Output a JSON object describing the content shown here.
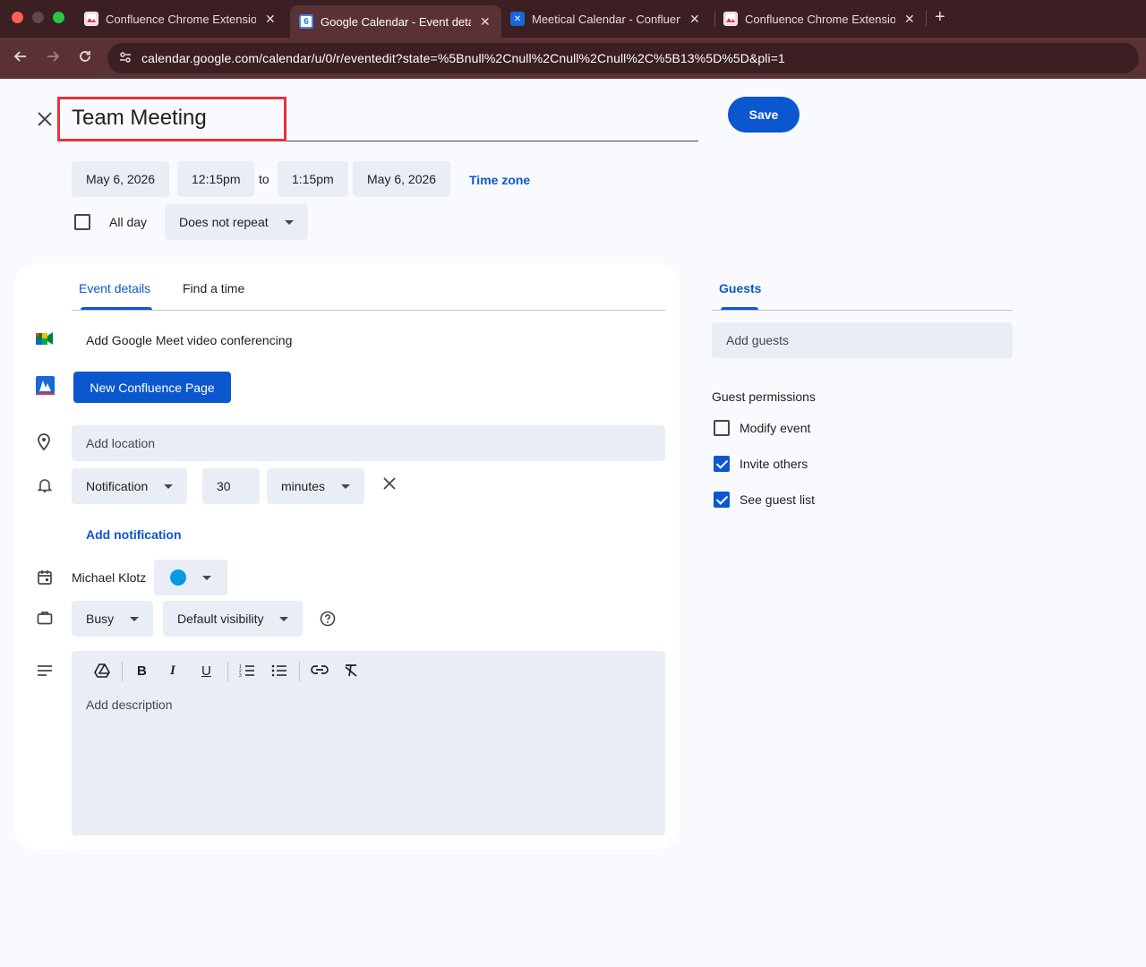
{
  "browser": {
    "tabs": [
      {
        "title": "Confluence Chrome Extension",
        "active": false
      },
      {
        "title": "Google Calendar - Event details",
        "active": true
      },
      {
        "title": "Meetical Calendar - Confluence",
        "active": false
      },
      {
        "title": "Confluence Chrome Extension",
        "active": false
      }
    ],
    "url": "calendar.google.com/calendar/u/0/r/eventedit?state=%5Bnull%2Cnull%2Cnull%2Cnull%2C%5B13%5D%5D&pli=1",
    "calendar_favicon_number": "6"
  },
  "event": {
    "title": "Team Meeting",
    "save_label": "Save",
    "start_date": "May 6, 2026",
    "start_time": "12:15pm",
    "to_label": "to",
    "end_time": "1:15pm",
    "end_date": "May 6, 2026",
    "time_zone_label": "Time zone",
    "all_day_label": "All day",
    "repeat_label": "Does not repeat"
  },
  "details": {
    "tab_event_details": "Event details",
    "tab_find_time": "Find a time",
    "meet_label": "Add Google Meet video conferencing",
    "confluence_button": "New Confluence Page",
    "location_placeholder": "Add location",
    "notification_type": "Notification",
    "notification_value": "30",
    "notification_unit": "minutes",
    "add_notification": "Add notification",
    "calendar_owner": "Michael Klotz",
    "calendar_color": "#039be5",
    "availability": "Busy",
    "visibility": "Default visibility",
    "description_placeholder": "Add description"
  },
  "guests": {
    "tab_label": "Guests",
    "input_placeholder": "Add guests",
    "permissions_title": "Guest permissions",
    "permissions": [
      {
        "label": "Modify event",
        "checked": false
      },
      {
        "label": "Invite others",
        "checked": true
      },
      {
        "label": "See guest list",
        "checked": true
      }
    ]
  },
  "colors": {
    "accent": "#0b57d0",
    "highlight": "#e8323c"
  }
}
